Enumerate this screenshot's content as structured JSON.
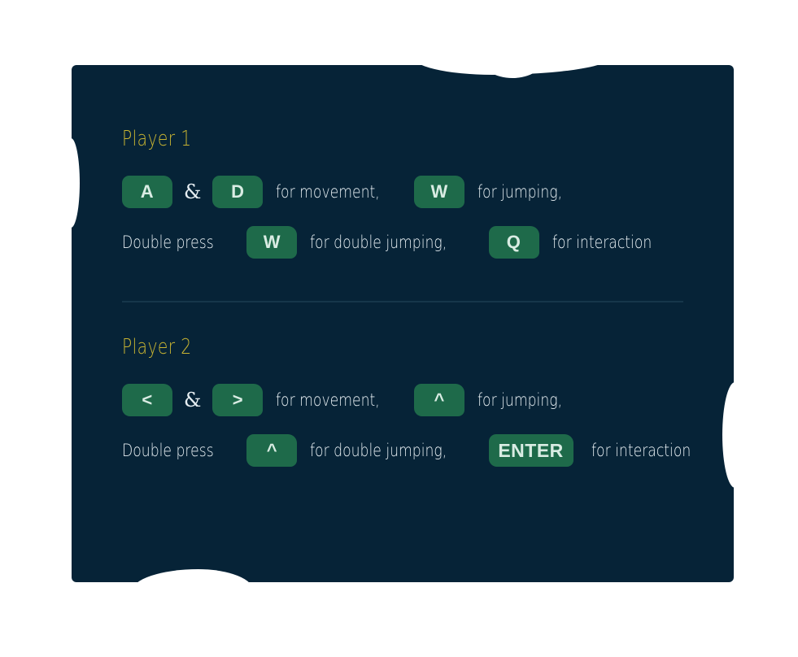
{
  "player1": {
    "title": "Player 1",
    "row1": {
      "key_left": "A",
      "amp": "&",
      "key_right": "D",
      "movement_text": "for movement,",
      "key_jump": "W",
      "jump_text": "for jumping,"
    },
    "row2": {
      "lead": "Double press",
      "key_double": "W",
      "double_text": "for double jumping,",
      "key_interact": "Q",
      "interact_text": "for interaction"
    }
  },
  "player2": {
    "title": "Player 2",
    "row1": {
      "key_left": "<",
      "amp": "&",
      "key_right": ">",
      "movement_text": "for movement,",
      "key_jump": "^",
      "jump_text": "for jumping,"
    },
    "row2": {
      "lead": "Double press",
      "key_double": "^",
      "double_text": "for double jumping,",
      "key_interact": "ENTER",
      "interact_text": "for interaction"
    }
  },
  "colors": {
    "panel_bg": "#062337",
    "key_bg": "#1e6a4a",
    "title": "#c8b432",
    "text": "#e6eef2"
  }
}
